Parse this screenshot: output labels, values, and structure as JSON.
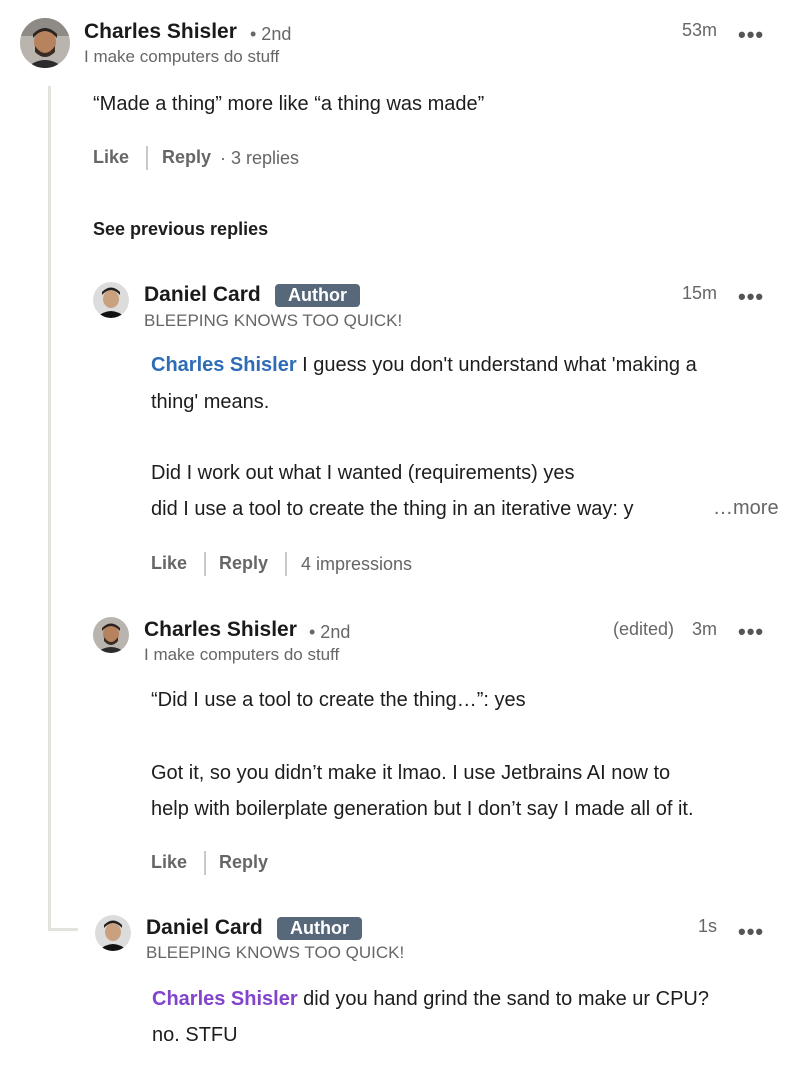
{
  "comments": [
    {
      "name": "Charles Shisler",
      "degree": "• 2nd",
      "headline": "I make computers do stuff",
      "time": "53m",
      "menu": "•••",
      "text": "“Made a thing” more like “a thing was made”",
      "like": "Like",
      "reply": "Reply",
      "replies": "· 3 replies"
    }
  ],
  "see_previous": "See previous replies",
  "replies": [
    {
      "name": "Daniel Card",
      "badge": "Author",
      "headline": "BLEEPING KNOWS TOO QUICK!",
      "time": "15m",
      "menu": "•••",
      "mention": "Charles Shisler",
      "text_1": " I guess you don't understand what 'making a",
      "text_2": "thing' means.",
      "text_3": "Did I work out what I wanted (requirements) yes",
      "text_4": "did I use a tool to create the thing in an iterative way: y",
      "more": "…more",
      "like": "Like",
      "reply": "Reply",
      "impressions": "4 impressions"
    },
    {
      "name": "Charles Shisler",
      "degree": "• 2nd",
      "headline": "I make computers do stuff",
      "edited": "(edited)",
      "time": "3m",
      "menu": "•••",
      "text_1": "“Did I use a tool to create the thing…”: yes",
      "text_2": "Got it, so you didn’t make it lmao. I use Jetbrains AI now to",
      "text_3": "help with boilerplate generation but I don’t say I made all of it.",
      "like": "Like",
      "reply": "Reply"
    },
    {
      "name": "Daniel Card",
      "badge": "Author",
      "headline": "BLEEPING KNOWS TOO QUICK!",
      "time": "1s",
      "menu": "•••",
      "mention": "Charles Shisler",
      "text_1": " did you hand grind the sand to make ur CPU?",
      "text_2": "no. STFU"
    }
  ],
  "colors": {
    "mention_blue": "#2e6cb5",
    "mention_purple": "#8344cc",
    "badge_bg": "#56687a",
    "thread_line": "#e4e2dc"
  }
}
